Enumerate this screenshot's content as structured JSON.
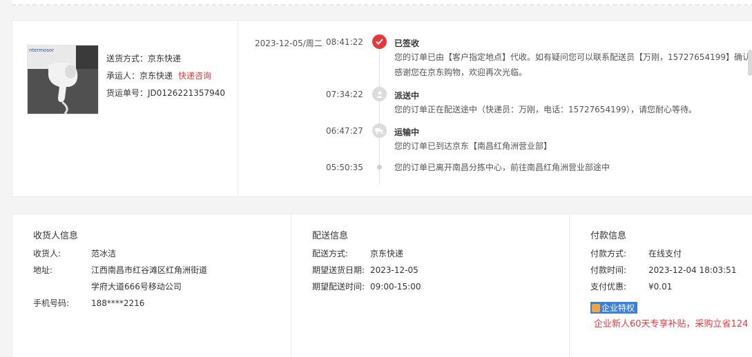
{
  "product": {
    "image_brand_text": "ntermosor"
  },
  "shipping": {
    "method_label": "送货方式：",
    "method_value": "京东快递",
    "carrier_label": "承运人：",
    "carrier_value": "京东快递",
    "carrier_link": "快递咨询",
    "tracking_label": "货运单号：",
    "tracking_value": "JD0126221357940"
  },
  "timeline": {
    "date": "2023-12-05/周二",
    "events": [
      {
        "time": "08:41:22",
        "title": "已签收",
        "icon": "check-icon",
        "lines": [
          "您的订单已由【客户指定地点】代收。如有疑问您可以联系配送员【万刚，15727654199】确认。",
          "感谢您在京东购物，欢迎再次光临。"
        ]
      },
      {
        "time": "07:34:22",
        "title": "派送中",
        "icon": "courier-icon",
        "lines": [
          "您的订单正在配送途中（快递员：万刚，电话：15727654199），请您耐心等待。"
        ]
      },
      {
        "time": "06:47:27",
        "title": "运输中",
        "icon": "transport-icon",
        "lines": [
          "您的订单已到达京东【南昌红角洲营业部】"
        ]
      },
      {
        "time": "05:50:35",
        "title": "",
        "icon": "dot-icon",
        "lines": [
          "您的订单已离开南昌分拣中心，前往南昌红角洲营业部途中"
        ]
      }
    ]
  },
  "receiver": {
    "title": "收货人信息",
    "name_label": "收货人:",
    "name_value": "范冰洁",
    "addr_label": "地址:",
    "addr_line1": "江西南昌市红谷滩区红角洲街道",
    "addr_line2": "学府大道666号移动公司",
    "phone_label": "手机号码:",
    "phone_value": "188****2216"
  },
  "delivery": {
    "title": "配送信息",
    "method_label": "配送方式:",
    "method_value": "京东快递",
    "date_label": "期望送货日期:",
    "date_value": "2023-12-05",
    "time_label": "期望配送时间:",
    "time_value": "09:00-15:00"
  },
  "payment": {
    "title": "付款信息",
    "method_label": "付款方式:",
    "method_value": "在线支付",
    "time_label": "付款时间:",
    "time_value": "2023-12-04 18:03:51",
    "discount_label": "支付优惠:",
    "discount_value": "¥0.01",
    "badge_label": "企业特权",
    "promo_text": "企业新人60天专享补贴，采购立省124"
  },
  "colors": {
    "accent_red": "#e4393c",
    "badge_blue": "#3b7fd9"
  }
}
